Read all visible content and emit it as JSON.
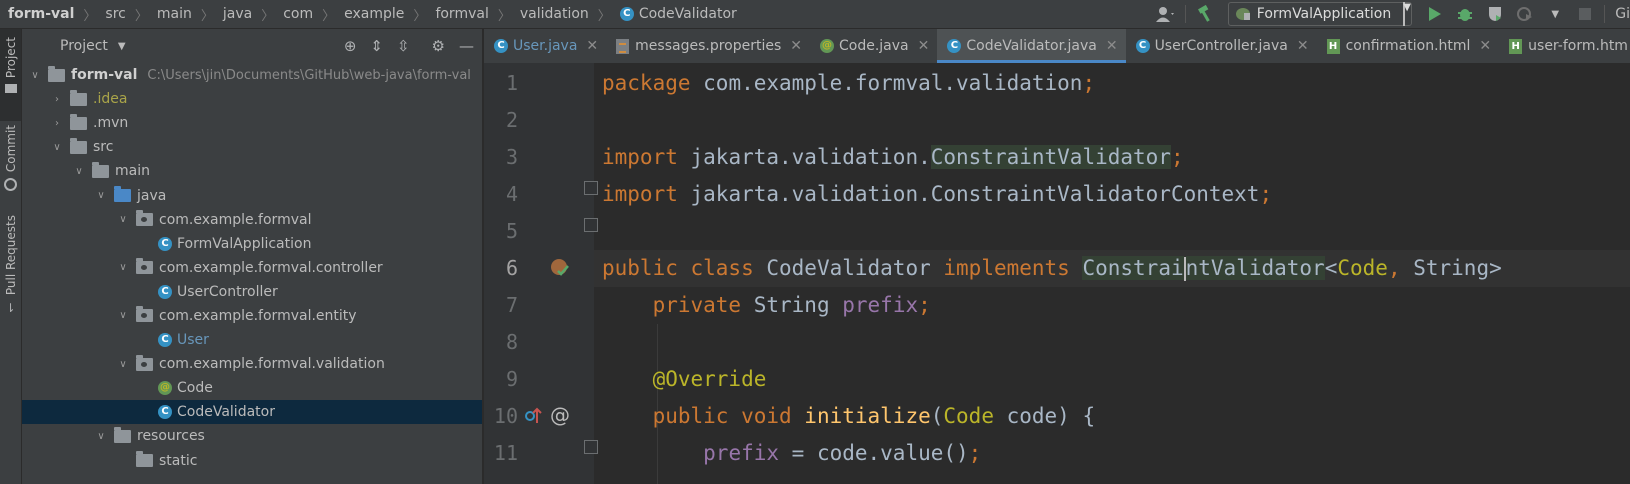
{
  "breadcrumb": {
    "items": [
      "form-val",
      "src",
      "main",
      "java",
      "com",
      "example",
      "formval",
      "validation",
      "CodeValidator"
    ]
  },
  "toolbar": {
    "run_config": "FormValApplication",
    "vcs_label": "Gi"
  },
  "tool_strip": {
    "items": [
      "Project",
      "Commit",
      "Pull Requests"
    ]
  },
  "project_panel": {
    "title": "Project",
    "tree": [
      {
        "label": "form-val",
        "path": "C:\\Users\\jin\\Documents\\GitHub\\web-java\\form-val"
      },
      {
        "label": ".idea"
      },
      {
        "label": ".mvn"
      },
      {
        "label": "src"
      },
      {
        "label": "main"
      },
      {
        "label": "java"
      },
      {
        "label": "com.example.formval"
      },
      {
        "label": "FormValApplication"
      },
      {
        "label": "com.example.formval.controller"
      },
      {
        "label": "UserController"
      },
      {
        "label": "com.example.formval.entity"
      },
      {
        "label": "User"
      },
      {
        "label": "com.example.formval.validation"
      },
      {
        "label": "Code"
      },
      {
        "label": "CodeValidator"
      },
      {
        "label": "resources"
      },
      {
        "label": "static"
      }
    ]
  },
  "editor": {
    "tabs": [
      {
        "label": "User.java"
      },
      {
        "label": "messages.properties"
      },
      {
        "label": "Code.java"
      },
      {
        "label": "CodeValidator.java"
      },
      {
        "label": "UserController.java"
      },
      {
        "label": "confirmation.html"
      },
      {
        "label": "user-form.htm"
      }
    ],
    "line_numbers": [
      "1",
      "2",
      "3",
      "4",
      "5",
      "6",
      "7",
      "8",
      "9",
      "10",
      "11"
    ],
    "code": {
      "l1_kw": "package ",
      "l1_rest": "com.example.formval.validation",
      "l1_semi": ";",
      "l3_kw": "import ",
      "l3_pre": "jakarta.validation.",
      "l3_hl": "ConstraintValidator",
      "l3_semi": ";",
      "l4_kw": "import ",
      "l4_rest": "jakarta.validation.ConstraintValidatorContext",
      "l4_semi": ";",
      "l6_kw1": "public class ",
      "l6_name": "CodeValidator ",
      "l6_kw2": "implements ",
      "l6_hl_a": "Constrai",
      "l6_hl_b": "ntValidator",
      "l6_lt": "<",
      "l6_t1": "Code",
      "l6_comma": ", ",
      "l6_t2": "String",
      "l6_gt": ">",
      "l7_kw": "private ",
      "l7_type": "String ",
      "l7_fld": "prefix",
      "l7_semi": ";",
      "l9_ann": "@Override",
      "l10_kw": "public void ",
      "l10_fn": "initialize",
      "l10_open": "(",
      "l10_type": "Code",
      "l10_rest": " code) {",
      "l11_fld": "prefix",
      "l11_rest": " = code.value()",
      "l11_semi": ";"
    }
  },
  "colors": {
    "keyword": "#cc7832",
    "annotation": "#bbb529",
    "field": "#9876aa",
    "method": "#ffc66d",
    "selection": "#0d293e",
    "accent": "#4a88c7"
  }
}
